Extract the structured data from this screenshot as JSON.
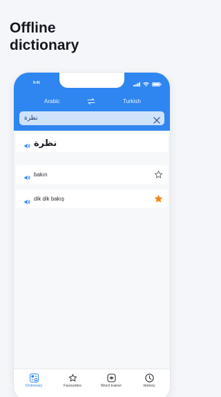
{
  "headline": {
    "line1": "Offline",
    "line2": "dictionary"
  },
  "status_bar": {
    "time": "9:41"
  },
  "languages": {
    "source": "Arabic",
    "target": "Turkish"
  },
  "search": {
    "query": "نظرة"
  },
  "word": {
    "text": "نظرة"
  },
  "translations": [
    {
      "text": "bakın",
      "favourite": false
    },
    {
      "text": "dik dik bakış",
      "favourite": true
    }
  ],
  "tabs": [
    {
      "label": "Dictionary",
      "icon": "dictionary-icon",
      "active": true
    },
    {
      "label": "Favourites",
      "icon": "star-icon",
      "active": false
    },
    {
      "label": "Word trainer",
      "icon": "word-trainer-icon",
      "active": false
    },
    {
      "label": "History",
      "icon": "clock-icon",
      "active": false
    }
  ],
  "colors": {
    "accent": "#2f86f0",
    "star_active": "#f08a1c",
    "background": "#f4f6f9"
  }
}
